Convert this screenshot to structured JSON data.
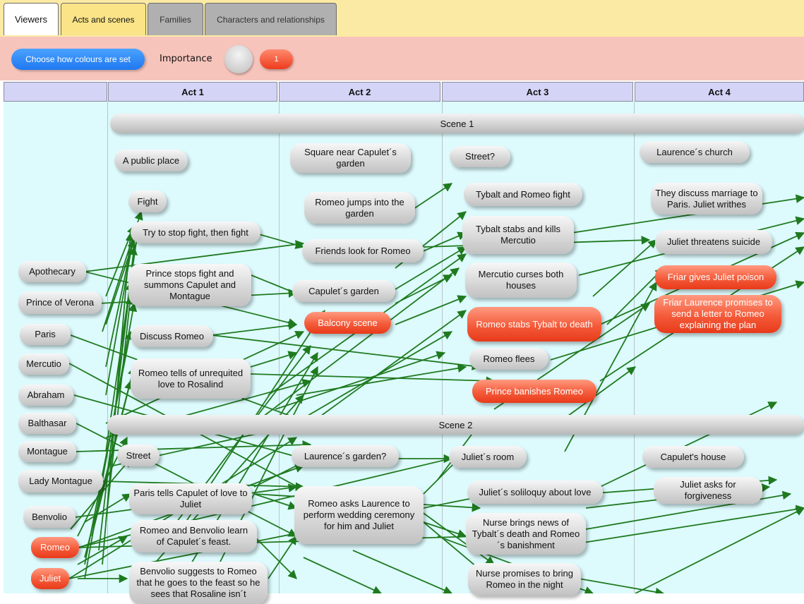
{
  "tabs": {
    "viewers": "Viewers",
    "acts": "Acts and scenes",
    "families": "Families",
    "chars": "Characters and relationships"
  },
  "toolbar": {
    "choose_colours": "Choose how colours are set",
    "importance_label": "Importance",
    "importance_value": "1"
  },
  "acts": [
    "Act 1",
    "Act 2",
    "Act 3",
    "Act 4"
  ],
  "scenes": [
    "Scene 1",
    "Scene 2"
  ],
  "colors": {
    "edge": "#1f7a1f",
    "hot": "#ee3b1c",
    "canvas": "#ddfafd",
    "act_header": "#d4d4f7"
  },
  "characters": [
    "Apothecary",
    "Prince of Verona",
    "Paris",
    "Mercutio",
    "Abraham",
    "Balthasar",
    "Montague",
    "Lady Montague",
    "Benvolio",
    "Romeo",
    "Juliet"
  ],
  "nodes": {
    "a1s1": [
      "A public place",
      "Fight",
      "Try to stop fight, then fight",
      "Prince stops fight and summons Capulet and Montague",
      "Discuss Romeo",
      "Romeo tells of unrequited love to Rosalind"
    ],
    "a1s2": [
      "Street",
      "Paris tells Capulet of love to Juliet",
      "Romeo and Benvolio learn of Capulet´s feast.",
      "Benvolio suggests to Romeo that he goes to the feast so he sees that Rosaline isn´t"
    ],
    "a2s1": [
      "Square near Capulet´s garden",
      "Romeo jumps into the garden",
      "Friends look for Romeo",
      "Capulet´s garden",
      "Balcony scene"
    ],
    "a2s2": [
      "Laurence´s garden?",
      "Romeo asks Laurence to perform wedding ceremony for him and Juliet"
    ],
    "a3s1": [
      "Street?",
      "Tybalt and Romeo fight",
      "Tybalt stabs and kills Mercutio",
      "Mercutio curses both houses",
      "Romeo stabs Tybalt to death",
      "Romeo flees",
      "Prince banishes Romeo"
    ],
    "a3s2": [
      "Juliet´s room",
      "Juliet´s soliloquy about love",
      "Nurse brings news of Tybalt´s death and Romeo´s banishment",
      "Nurse promises to bring Romeo in the night"
    ],
    "a4s1": [
      "Laurence´s church",
      "They discuss marriage to Paris. Juliet writhes",
      "Juliet threatens suicide",
      "Friar gives Juliet poison",
      "Friar Laurence promises to send a letter to Romeo explaining the plan"
    ],
    "a4s2": [
      "Capulet's house",
      "Juliet asks for forgiveness"
    ]
  }
}
